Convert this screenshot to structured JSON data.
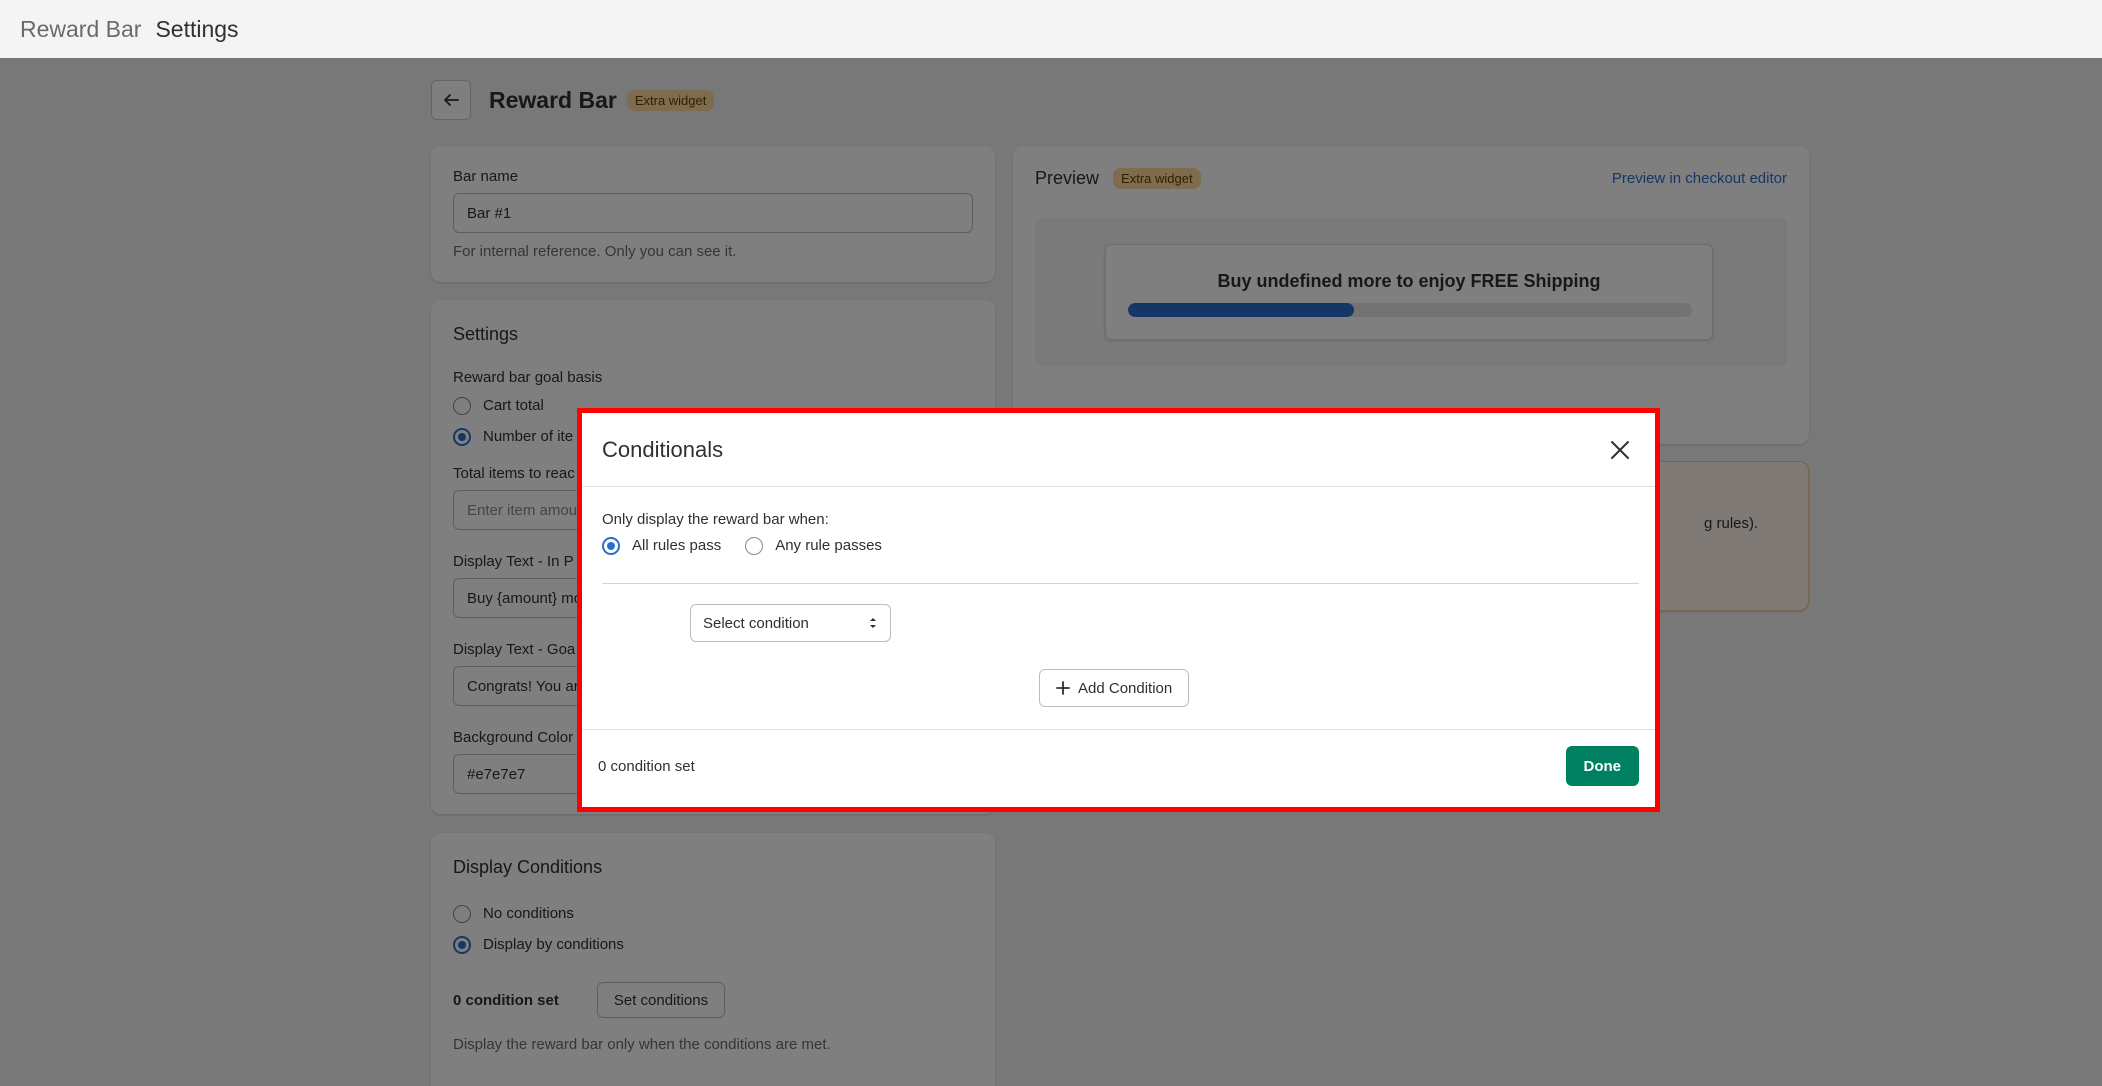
{
  "topbar": {
    "app": "Reward Bar",
    "current": "Settings"
  },
  "header": {
    "title": "Reward Bar",
    "badge": "Extra widget"
  },
  "bar_name": {
    "label": "Bar name",
    "value": "Bar #1",
    "help": "For internal reference. Only you can see it."
  },
  "settings": {
    "title": "Settings",
    "goal_basis_label": "Reward bar goal basis",
    "goal_options": [
      "Cart total",
      "Number of ite"
    ],
    "total_items_label": "Total items to reac",
    "total_items_placeholder": "Enter item amou",
    "display_text_progress_label": "Display Text - In P",
    "display_text_progress_value": "Buy {amount} mo",
    "display_text_goal_label": "Display Text - Goa",
    "display_text_goal_value": "Congrats! You ar",
    "bg_color_label": "Background Color",
    "bg_color_value": "#e7e7e7"
  },
  "display_conditions": {
    "title": "Display Conditions",
    "options": [
      "No conditions",
      "Display by conditions"
    ],
    "count_text": "0 condition set",
    "button": "Set conditions",
    "help": "Display the reward bar only when the conditions are met."
  },
  "preview": {
    "title": "Preview",
    "badge": "Extra widget",
    "link": "Preview in checkout editor",
    "bar_text": "Buy undefined more to enjoy FREE Shipping",
    "progress": 0.4
  },
  "notice": {
    "text": "g rules)."
  },
  "modal": {
    "title": "Conditionals",
    "prompt": "Only display the reward bar when:",
    "options": [
      "All rules pass",
      "Any rule passes"
    ],
    "select_placeholder": "Select condition",
    "add_button": "Add Condition",
    "count_text": "0 condition set",
    "done_button": "Done"
  },
  "colors": {
    "accent": "#2c6ecb",
    "primary": "#008060",
    "highlight": "#ff0000",
    "badge": "#ffd79d"
  }
}
